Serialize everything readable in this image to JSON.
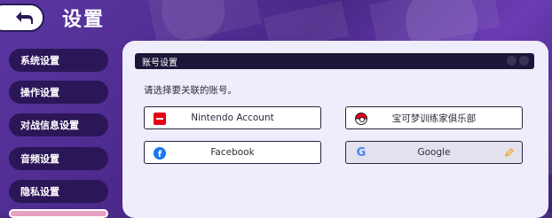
{
  "header": {
    "title": "设置",
    "back_icon": "back-arrow-icon"
  },
  "sidebar": {
    "items": [
      {
        "label": "系统设置"
      },
      {
        "label": "操作设置"
      },
      {
        "label": "对战信息设置"
      },
      {
        "label": "音频设置"
      },
      {
        "label": "隐私设置"
      }
    ]
  },
  "panel": {
    "heading": "账号设置",
    "prompt": "请选择要关联的账号。",
    "accounts": [
      {
        "label": "Nintendo Account",
        "icon": "nintendo-icon"
      },
      {
        "label": "宝可梦训练家俱乐部",
        "icon": "pokeball-icon"
      },
      {
        "label": "Facebook",
        "icon": "facebook-icon"
      },
      {
        "label": "Google",
        "icon": "google-icon",
        "state": "selected",
        "edit_icon": "pencil-icon"
      }
    ]
  },
  "colors": {
    "background": "#4c2a86",
    "sidebar_item": "#2b1658",
    "panel": "#efedfb",
    "panel_header": "#1e1638",
    "nintendo_red": "#e60012",
    "facebook_blue": "#1877f2",
    "pencil_orange": "#f5a623"
  }
}
